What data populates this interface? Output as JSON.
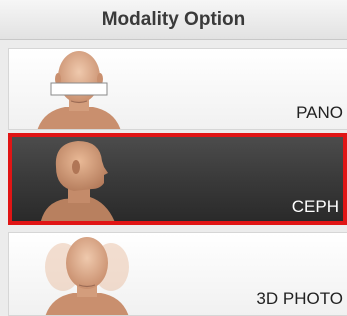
{
  "header": {
    "title": "Modality Option"
  },
  "options": [
    {
      "label": "PANO",
      "icon": "face-with-bite-block-icon",
      "selected": false
    },
    {
      "label": "CEPH",
      "icon": "head-profile-icon",
      "selected": true
    },
    {
      "label": "3D PHOTO",
      "icon": "multi-angle-face-icon",
      "selected": false
    }
  ],
  "colors": {
    "selection_border": "#e01515",
    "selected_background": "#3a3a3a",
    "skin": "#d9a888"
  }
}
